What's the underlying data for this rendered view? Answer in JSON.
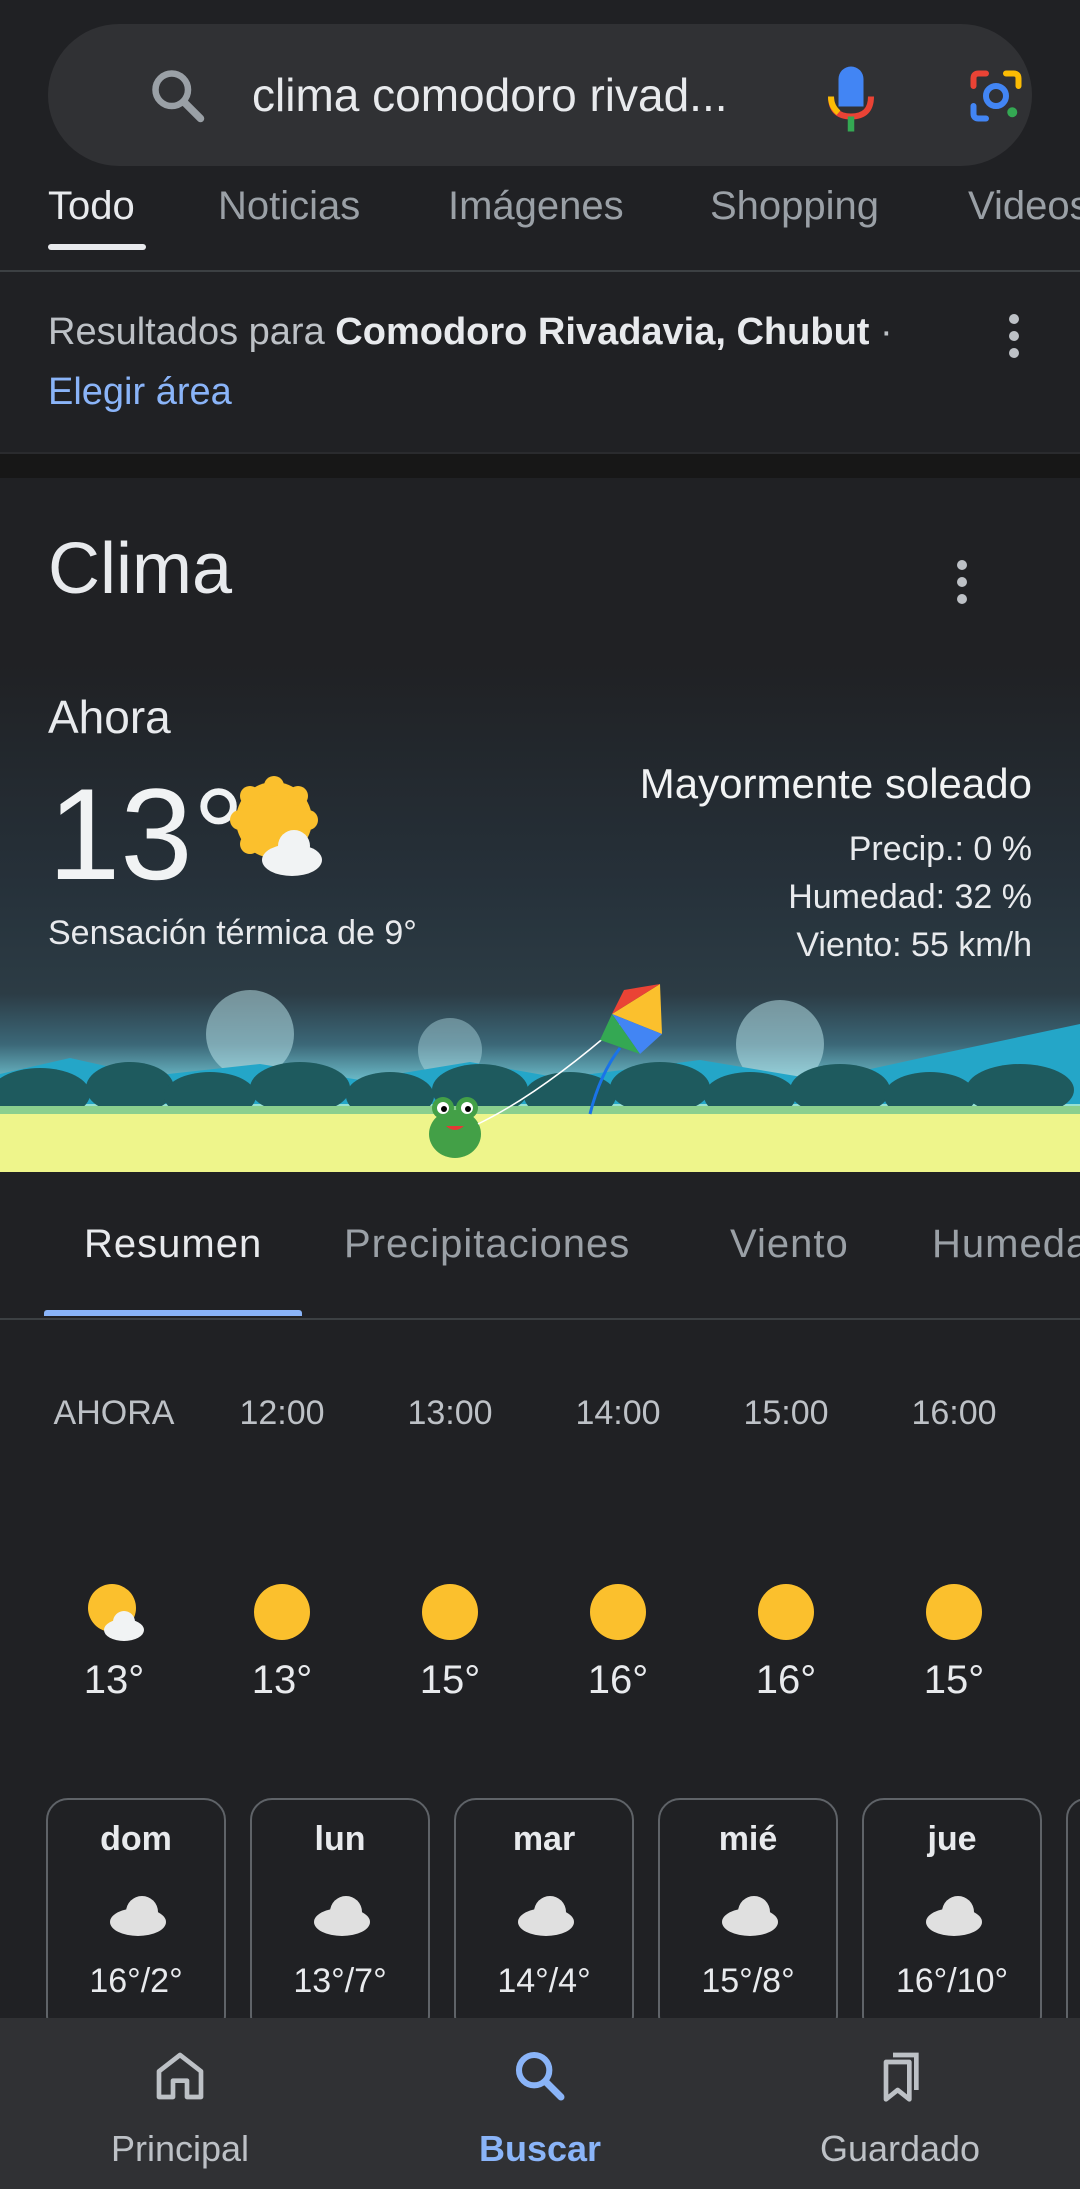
{
  "search": {
    "query": "clima comodoro rivad..."
  },
  "tabs": [
    "Todo",
    "Noticias",
    "Imágenes",
    "Shopping",
    "Videos"
  ],
  "location": {
    "prefix": "Resultados para ",
    "place": "Comodoro Rivadavia, Chubut",
    "dot": " ·",
    "choose_area": "Elegir área"
  },
  "weather": {
    "title": "Clima",
    "now_label": "Ahora",
    "temperature": "13°",
    "feels_like": "Sensación térmica de 9°",
    "condition": "Mayormente soleado",
    "precip": "Precip.: 0 %",
    "humidity": "Humedad: 32 %",
    "wind": "Viento: 55 km/h",
    "subtabs": [
      "Resumen",
      "Precipitaciones",
      "Viento",
      "Humedad"
    ],
    "hourly": [
      {
        "time": "AHORA",
        "temp": "13°",
        "icon": "partly-sunny-icon"
      },
      {
        "time": "12:00",
        "temp": "13°",
        "icon": "sun-icon"
      },
      {
        "time": "13:00",
        "temp": "15°",
        "icon": "sun-icon"
      },
      {
        "time": "14:00",
        "temp": "16°",
        "icon": "sun-icon"
      },
      {
        "time": "15:00",
        "temp": "16°",
        "icon": "sun-icon"
      },
      {
        "time": "16:00",
        "temp": "15°",
        "icon": "sun-icon"
      }
    ],
    "daily": [
      {
        "day": "dom",
        "range": "16°/2°",
        "icon": "cloud-icon"
      },
      {
        "day": "lun",
        "range": "13°/7°",
        "icon": "cloud-icon"
      },
      {
        "day": "mar",
        "range": "14°/4°",
        "icon": "cloud-icon"
      },
      {
        "day": "mié",
        "range": "15°/8°",
        "icon": "cloud-icon"
      },
      {
        "day": "jue",
        "range": "16°/10°",
        "icon": "cloud-icon"
      }
    ]
  },
  "bottom_nav": {
    "home": "Principal",
    "search": "Buscar",
    "saved": "Guardado"
  },
  "colors": {
    "background": "#202124",
    "accent": "#8ab4f8",
    "sun": "#fbc02d"
  }
}
